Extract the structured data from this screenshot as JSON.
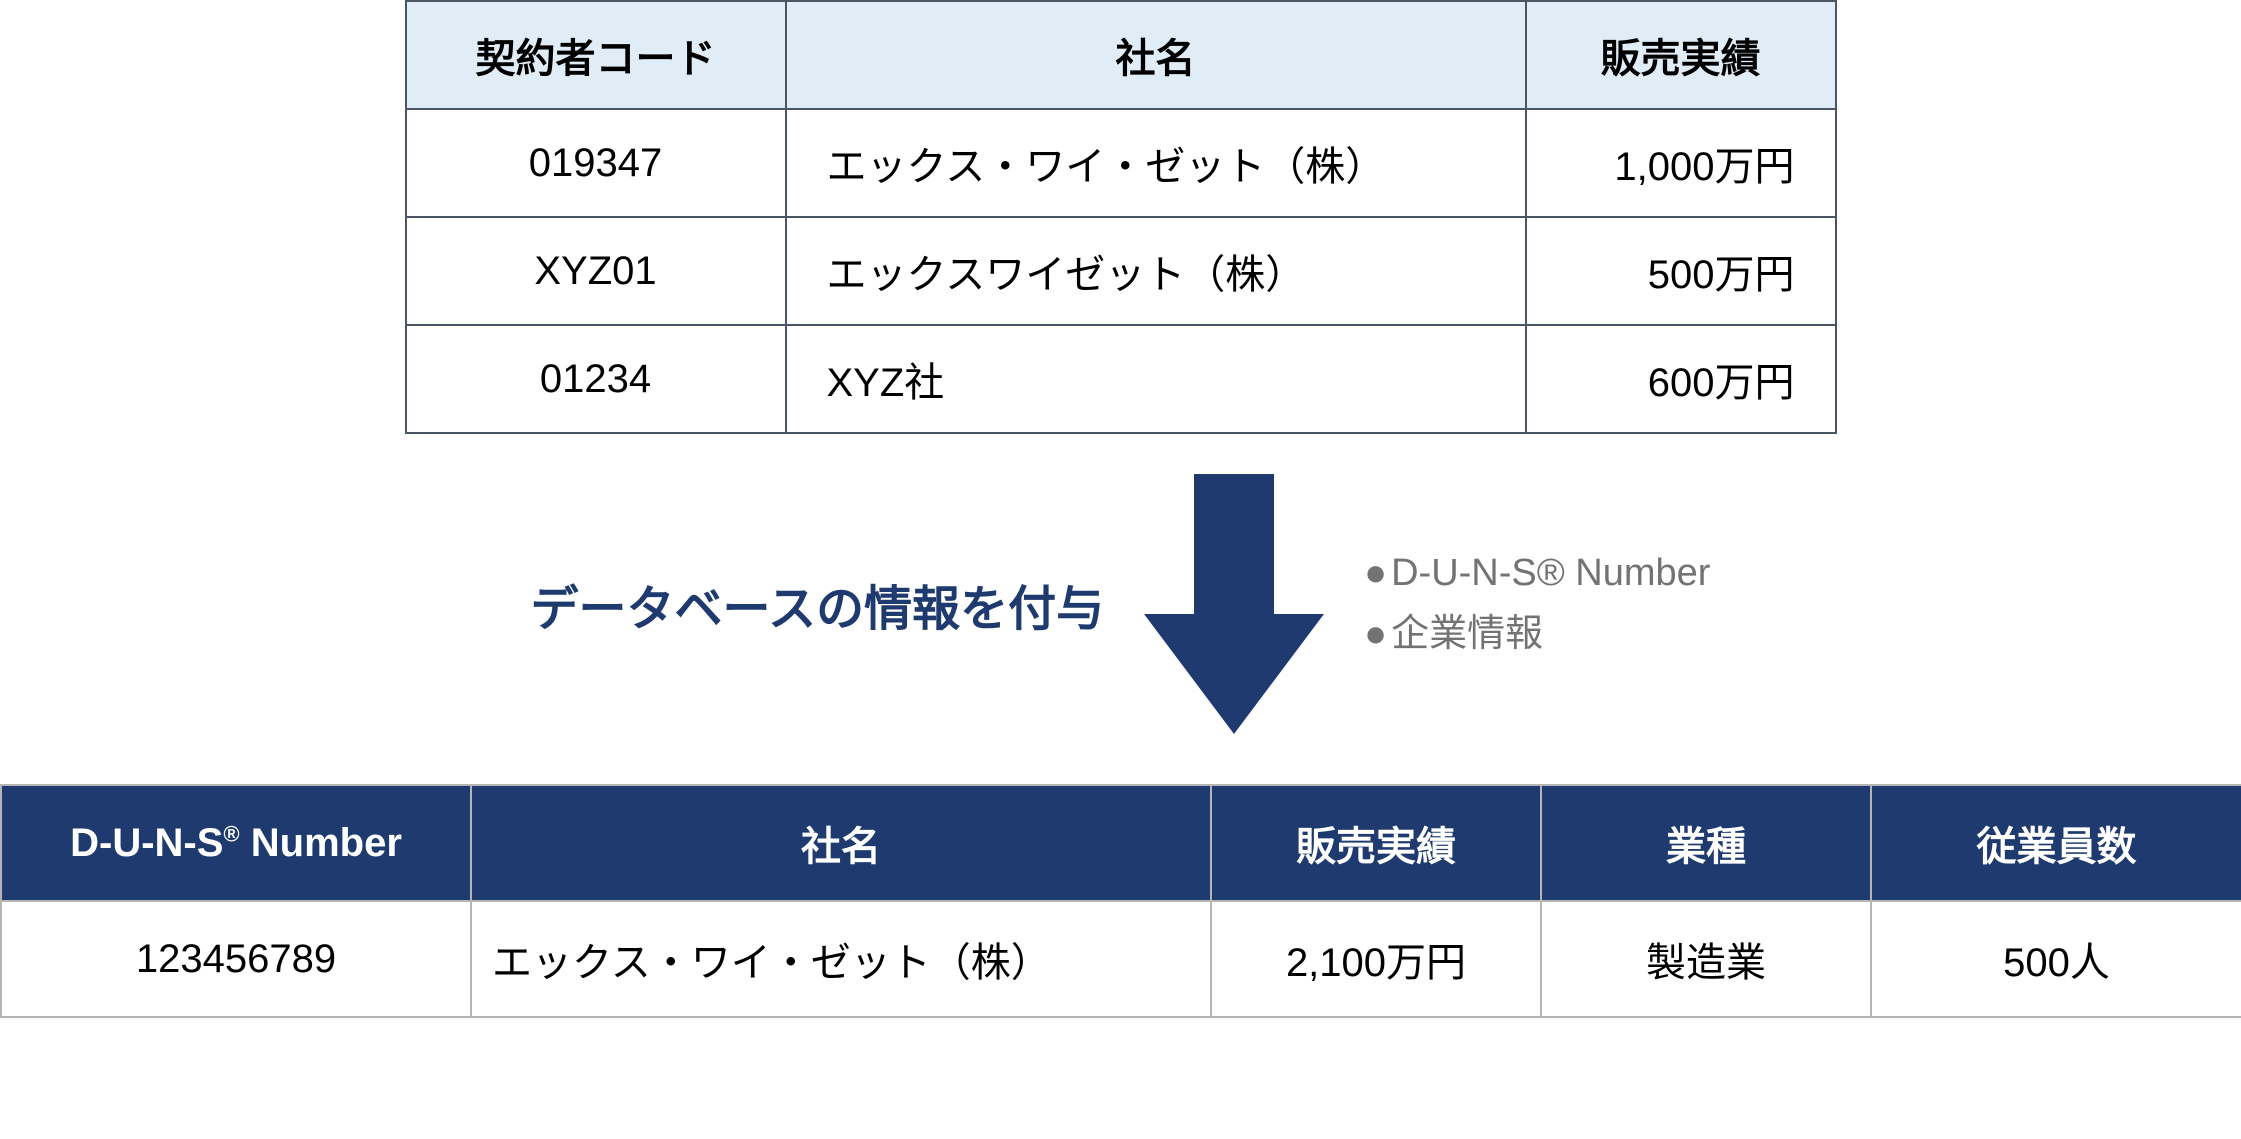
{
  "top_table": {
    "headers": {
      "code": "契約者コード",
      "name": "社名",
      "sales": "販売実績"
    },
    "rows": [
      {
        "code": "019347",
        "name": "エックス・ワイ・ゼット（株）",
        "sales": "1,000万円"
      },
      {
        "code": "XYZ01",
        "name": "エックスワイゼット（株）",
        "sales": "500万円"
      },
      {
        "code": "01234",
        "name": "XYZ社",
        "sales": "600万円"
      }
    ]
  },
  "middle": {
    "label": "データベースの情報を付与",
    "bullets": [
      "D-U-N-S® Number",
      "企業情報"
    ],
    "arrow_color": "#1e3a6e"
  },
  "bottom_table": {
    "headers": {
      "duns_pre": "D-U-N-S",
      "duns_sup": "®",
      "duns_post": " Number",
      "name": "社名",
      "sales": "販売実績",
      "industry": "業種",
      "employees": "従業員数"
    },
    "rows": [
      {
        "duns": "123456789",
        "name": "エックス・ワイ・ゼット（株）",
        "sales": "2,100万円",
        "industry": "製造業",
        "employees": "500人"
      }
    ]
  }
}
